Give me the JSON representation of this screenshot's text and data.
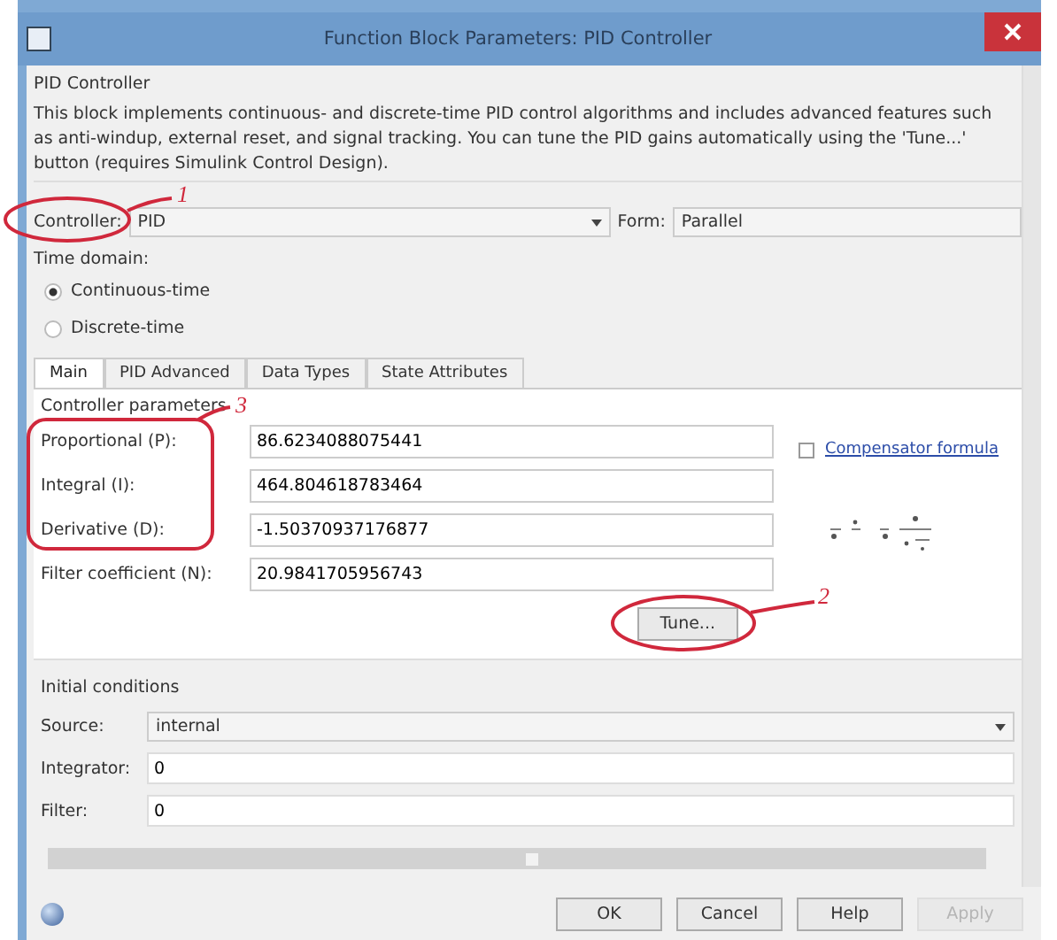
{
  "window": {
    "title": "Function Block Parameters: PID Controller"
  },
  "block_name": "PID Controller",
  "description": "This block implements continuous- and discrete-time PID control algorithms and includes advanced features such as anti-windup, external reset, and signal tracking. You can tune the PID gains automatically using the 'Tune...' button (requires Simulink Control Design).",
  "controller": {
    "label": "Controller:",
    "value": "PID"
  },
  "form": {
    "label": "Form:",
    "value": "Parallel"
  },
  "time_domain": {
    "label": "Time domain:",
    "options": [
      {
        "label": "Continuous-time",
        "selected": true
      },
      {
        "label": "Discrete-time",
        "selected": false
      }
    ]
  },
  "tabs": [
    {
      "label": "Main",
      "selected": true
    },
    {
      "label": "PID Advanced",
      "selected": false
    },
    {
      "label": "Data Types",
      "selected": false
    },
    {
      "label": "State Attributes",
      "selected": false
    }
  ],
  "parameters_heading": "Controller parameters",
  "parameters": [
    {
      "label": "Proportional (P):",
      "value": "86.6234088075441"
    },
    {
      "label": "Integral (I):",
      "value": "464.804618783464"
    },
    {
      "label": "Derivative (D):",
      "value": "-1.50370937176877"
    },
    {
      "label": "Filter coefficient (N):",
      "value": "20.9841705956743"
    }
  ],
  "compensator_formula": {
    "label": "Compensator formula",
    "checked": false
  },
  "tune_button": "Tune...",
  "initial_conditions": {
    "heading": "Initial conditions",
    "source": {
      "label": "Source:",
      "value": "internal"
    },
    "integrator": {
      "label": "Integrator:",
      "value": "0"
    },
    "filter": {
      "label": "Filter:",
      "value": "0"
    }
  },
  "buttons": [
    {
      "label": "OK",
      "disabled": false
    },
    {
      "label": "Cancel",
      "disabled": false
    },
    {
      "label": "Help",
      "disabled": false
    },
    {
      "label": "Apply",
      "disabled": true
    }
  ],
  "annotations": [
    {
      "label": "1"
    },
    {
      "label": "2"
    },
    {
      "label": "3"
    }
  ]
}
